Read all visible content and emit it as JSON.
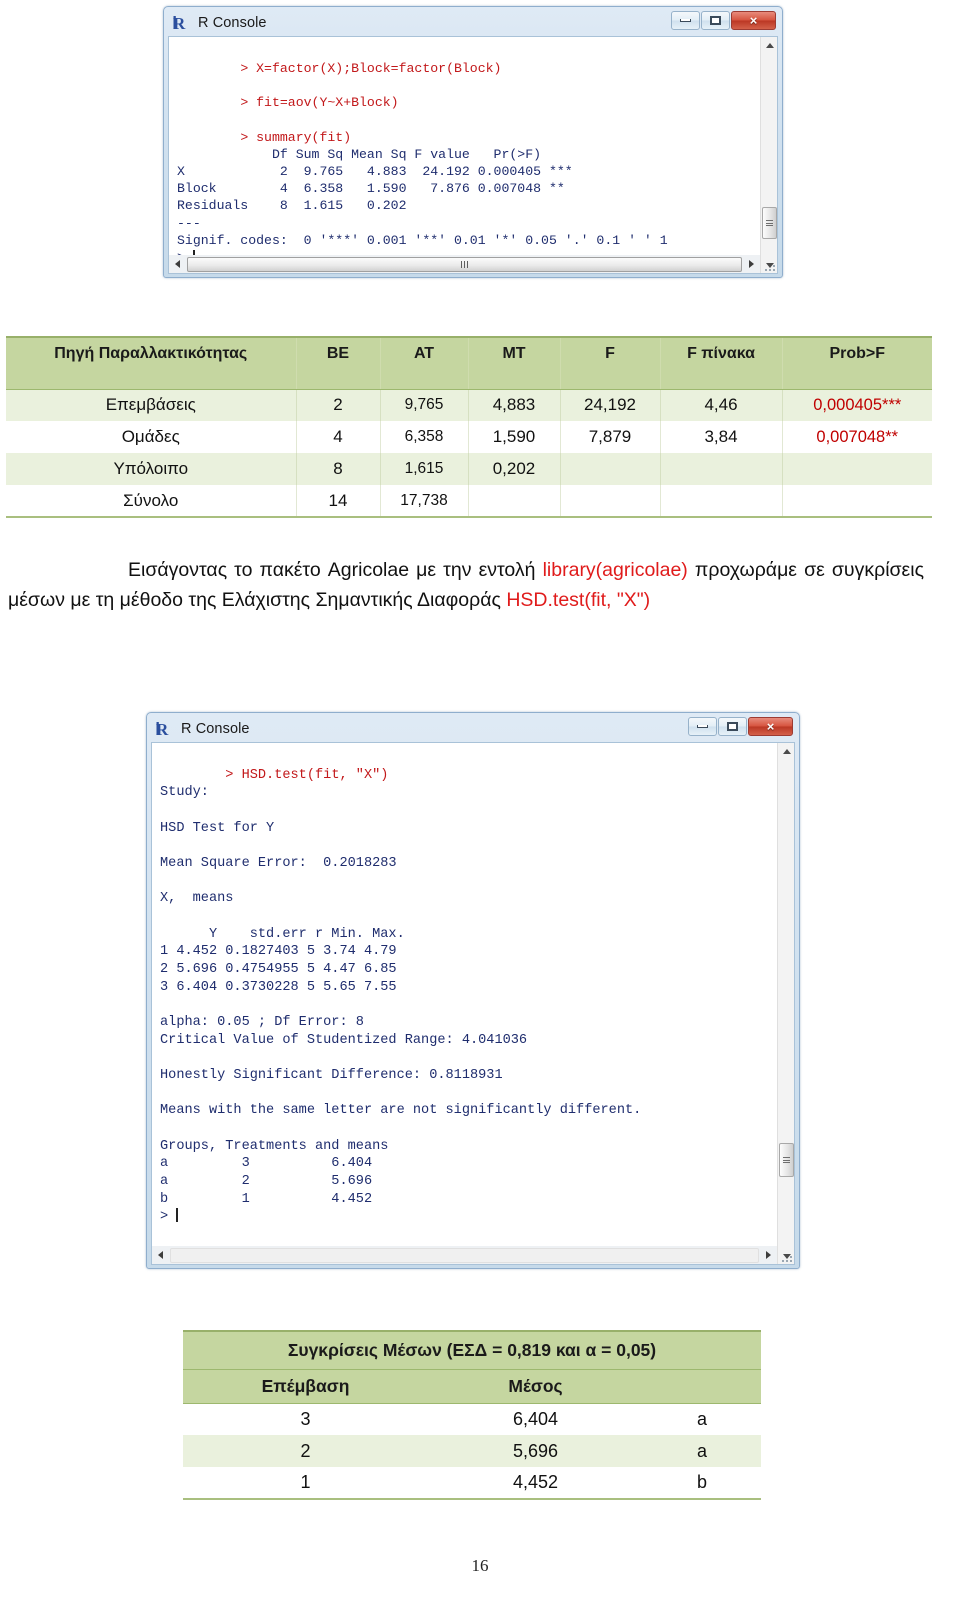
{
  "console1": {
    "title": "R Console",
    "window_buttons": {
      "minimize": "minimize-icon",
      "maximize": "maximize-icon",
      "close": "×"
    },
    "lines": [
      "> X=factor(X);Block=factor(Block)",
      "> fit=aov(Y~X+Block)",
      "> summary(fit)"
    ],
    "output": "            Df Sum Sq Mean Sq F value   Pr(>F)\nX            2  9.765   4.883  24.192 0.000405 ***\nBlock        4  6.358   1.590   7.876 0.007048 **\nResiduals    8  1.615   0.202\n---\nSignif. codes:  0 '***' 0.001 '**' 0.01 '*' 0.05 '.' 0.1 ' ' 1\n> "
  },
  "anova_table": {
    "headers": [
      "Πηγή Παραλλακτικότητας",
      "ΒΕ",
      "ΑΤ",
      "ΜΤ",
      "F",
      "F πίνακα",
      "Prob>F"
    ],
    "rows": [
      {
        "source": "Επεμβάσεις",
        "be": "2",
        "at": "9,765",
        "mt": "4,883",
        "f": "24,192",
        "ftab": "4,46",
        "prob": "0,000405***"
      },
      {
        "source": "Ομάδες",
        "be": "4",
        "at": "6,358",
        "mt": "1,590",
        "f": "7,879",
        "ftab": "3,84",
        "prob": "0,007048**"
      },
      {
        "source": "Υπόλοιπο",
        "be": "8",
        "at": "1,615",
        "mt": "0,202",
        "f": "",
        "ftab": "",
        "prob": ""
      },
      {
        "source": "Σύνολο",
        "be": "14",
        "at": "17,738",
        "mt": "",
        "f": "",
        "ftab": "",
        "prob": ""
      }
    ]
  },
  "paragraph": {
    "part1": "Εισάγοντας το πακέτο Agricolae με την εντολή ",
    "code1": "library(agricolae)",
    "part2": " προχωράμε σε συγκρίσεις μέσων με τη μέθοδο της Ελάχιστης Σημαντικής Διαφοράς ",
    "code2": "HSD.test(fit, \"X\")"
  },
  "console2": {
    "title": "R Console",
    "window_buttons": {
      "minimize": "minimize-icon",
      "maximize": "maximize-icon",
      "close": "×"
    },
    "command": "> HSD.test(fit, \"X\")",
    "output": "\nStudy:\n\nHSD Test for Y\n\nMean Square Error:  0.2018283\n\nX,  means\n\n      Y    std.err r Min. Max.\n1 4.452 0.1827403 5 3.74 4.79\n2 5.696 0.4754955 5 4.47 6.85\n3 6.404 0.3730228 5 5.65 7.55\n\nalpha: 0.05 ; Df Error: 8\nCritical Value of Studentized Range: 4.041036\n\nHonestly Significant Difference: 0.8118931\n\nMeans with the same letter are not significantly different.\n\nGroups, Treatments and means\na         3          6.404\na         2          5.696\nb         1          4.452\n> "
  },
  "means_table": {
    "caption": "Συγκρίσεις Μέσων  (ΕΣΔ = 0,819 και α = 0,05)",
    "headers": [
      "Επέμβαση",
      "Μέσος",
      ""
    ],
    "rows": [
      {
        "treatment": "3",
        "mean": "6,404",
        "group": "a"
      },
      {
        "treatment": "2",
        "mean": "5,696",
        "group": "a"
      },
      {
        "treatment": "1",
        "mean": "4,452",
        "group": "b"
      }
    ]
  },
  "footer": {
    "page_number": "16"
  },
  "colors": {
    "header_green": "#c5d6a0",
    "row_alt_green": "#eaf1dd",
    "significance_red": "#c00000",
    "code_red": "#e01b1b",
    "console_text_blue": "#1f2d6e",
    "console_cmd_red": "#c2181a"
  }
}
